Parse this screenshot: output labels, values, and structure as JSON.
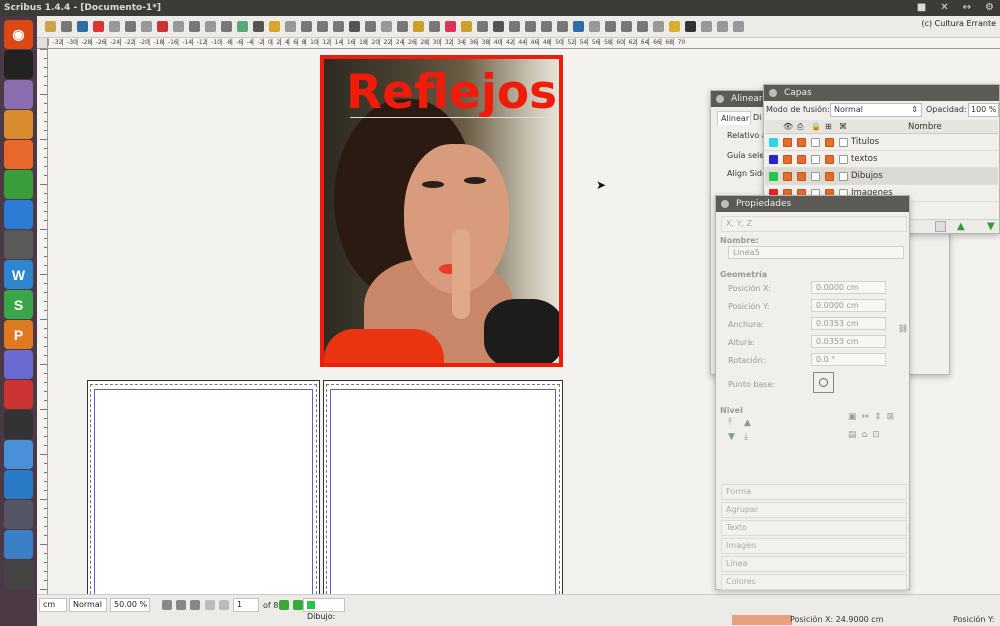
{
  "window": {
    "title": "Scribus 1.4.4 - [Documento-1*]",
    "controls": [
      "■",
      "✕",
      "↔",
      "⚙"
    ]
  },
  "launcher": {
    "items": [
      {
        "name": "ubuntu-icon",
        "glyph": "◉",
        "color": "#dd4814"
      },
      {
        "name": "terminal-icon",
        "glyph": "",
        "color": "#222"
      },
      {
        "name": "drive-icon",
        "glyph": "",
        "color": "#8a6fb0"
      },
      {
        "name": "files-icon",
        "glyph": "",
        "color": "#d88b2f"
      },
      {
        "name": "firefox-icon",
        "glyph": "",
        "color": "#e8682c"
      },
      {
        "name": "chrome-icon",
        "glyph": "",
        "color": "#3a9e3a"
      },
      {
        "name": "network-icon",
        "glyph": "",
        "color": "#2e7bd6"
      },
      {
        "name": "settings-icon",
        "glyph": "",
        "color": "#5a5a5a"
      },
      {
        "name": "writer-icon",
        "glyph": "W",
        "color": "#2e86d1"
      },
      {
        "name": "calc-icon",
        "glyph": "S",
        "color": "#3aa64a"
      },
      {
        "name": "impress-icon",
        "glyph": "P",
        "color": "#e07a22"
      },
      {
        "name": "software-icon",
        "glyph": "",
        "color": "#6a6ad0"
      },
      {
        "name": "app1-icon",
        "glyph": "",
        "color": "#c33"
      },
      {
        "name": "app2-icon",
        "glyph": "",
        "color": "#333"
      },
      {
        "name": "app3-icon",
        "glyph": "",
        "color": "#4a90d9"
      },
      {
        "name": "app4-icon",
        "glyph": "",
        "color": "#2a7ac8"
      },
      {
        "name": "app5-icon",
        "glyph": "",
        "color": "#556"
      },
      {
        "name": "app6-icon",
        "glyph": "",
        "color": "#3b7fc4"
      },
      {
        "name": "app7-icon",
        "glyph": "",
        "color": "#444"
      }
    ]
  },
  "toolbar": {
    "org_label": "(c) Cultura Errante"
  },
  "ruler": {
    "labels": "▏-32▏-30▏-28▏-26▏-24▏-22▏-20▏-18▏-16▏-14▏-12▏-10▏-8▏-6▏-4▏-2▏0▏2▏4▏6▏8▏10▏12▏14▏16▏18▏20▏22▏24▏26▏28▏30▏32▏34▏36▏38▏40▏42▏44▏46▏48▏50▏52▏54▏56▏58▏60▏62▏64▏66▏68▏70"
  },
  "canvas": {
    "cover_title": "Reflejos"
  },
  "alinear": {
    "title": "Alinear",
    "tab_active": "Alinear",
    "tab_other": "Di",
    "relativo": "Relativo a",
    "guia": "Guía selec",
    "align_side": "Align Side"
  },
  "capas": {
    "title": "Capas",
    "blend_label": "Modo de fusión:",
    "blend_value": "Normal",
    "opacity_label": "Opacidad:",
    "opacity_value": "100 %",
    "name_header": "Nombre",
    "layers": [
      {
        "name": "Titulos",
        "color": "#2ad7e8"
      },
      {
        "name": "textos",
        "color": "#2a22d0"
      },
      {
        "name": "Dibujos",
        "color": "#22c84a"
      },
      {
        "name": "Imagenes",
        "color": "#e82222"
      }
    ]
  },
  "props": {
    "title": "Propiedades",
    "xyz": "X, Y, Z",
    "nombre_label": "Nombre:",
    "nombre_value": "Linea5",
    "geometria": "Geometría",
    "pos_x_label": "Posición X:",
    "pos_x_value": "0.0000 cm",
    "pos_y_label": "Posición Y:",
    "pos_y_value": "0.0000 cm",
    "anchura_label": "Anchura:",
    "anchura_value": "0.0353 cm",
    "altura_label": "Altura:",
    "altura_value": "0.0353 cm",
    "rotacion_label": "Rotación:",
    "rotacion_value": "0.0 °",
    "punto_base_label": "Punto base:",
    "nivel": "Nivel",
    "sections": [
      "Forma",
      "Agrupar",
      "Texto",
      "Imagen",
      "Línea",
      "Colores"
    ]
  },
  "status": {
    "unit": "cm",
    "mode": "Normal",
    "zoom": "50.00 %",
    "page": "1",
    "of_pages": "of 8",
    "layer": "Dibujo:",
    "pos_x": "Posición X: 24.9000 cm",
    "pos_y": "Posición Y:"
  }
}
